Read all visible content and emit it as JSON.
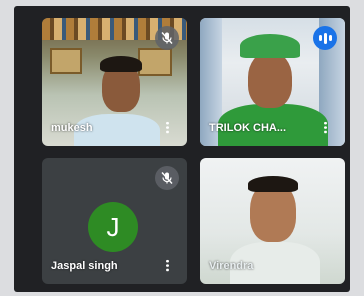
{
  "participants": [
    {
      "name": "mukesh",
      "muted": true
    },
    {
      "name": "TRILOK CHA...",
      "speaking": true
    },
    {
      "name": "Jaspal singh",
      "avatar_letter": "J",
      "avatar_color": "#2e8b24",
      "muted": true
    },
    {
      "name": "Virendra"
    }
  ],
  "colors": {
    "background": "#202124",
    "tile": "#3c4043",
    "speaking_indicator": "#1a73e8",
    "muted_badge": "#5f6368"
  },
  "icons": {
    "mute": "mic-off-icon",
    "speaking": "audio-level-icon",
    "menu": "more-vert-icon"
  }
}
